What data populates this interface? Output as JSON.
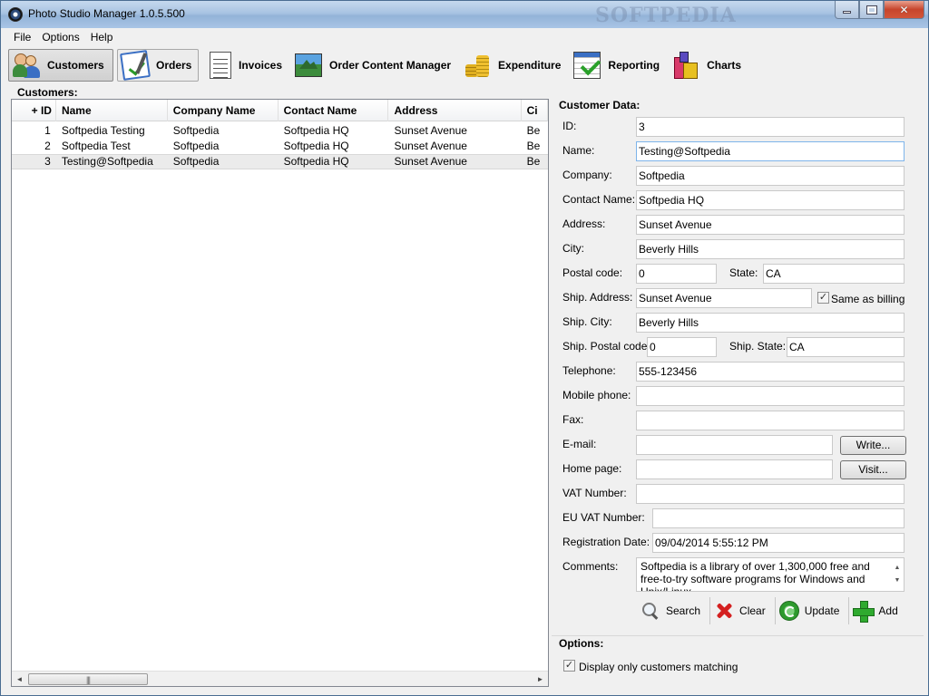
{
  "window": {
    "title": "Photo Studio Manager 1.0.5.500",
    "watermark": "SOFTPEDIA"
  },
  "menu": [
    "File",
    "Options",
    "Help"
  ],
  "toolbar": {
    "customers": "Customers",
    "orders": "Orders",
    "invoices": "Invoices",
    "content": "Order Content Manager",
    "expenditure": "Expenditure",
    "reporting": "Reporting",
    "charts": "Charts"
  },
  "customers_panel": {
    "label": "Customers:",
    "columns": {
      "id": "+ ID",
      "name": "Name",
      "company": "Company Name",
      "contact": "Contact Name",
      "address": "Address",
      "city": "Ci"
    },
    "rows": [
      {
        "id": "1",
        "name": "Softpedia Testing",
        "company": "Softpedia",
        "contact": "Softpedia HQ",
        "address": "Sunset Avenue",
        "city": "Be"
      },
      {
        "id": "2",
        "name": "Softpedia Test",
        "company": "Softpedia",
        "contact": "Softpedia HQ",
        "address": "Sunset Avenue",
        "city": "Be"
      },
      {
        "id": "3",
        "name": "Testing@Softpedia",
        "company": "Softpedia",
        "contact": "Softpedia HQ",
        "address": "Sunset Avenue",
        "city": "Be"
      }
    ],
    "scroll_grip": "|||"
  },
  "customer_data": {
    "label": "Customer Data:",
    "id_label": "ID:",
    "id": "3",
    "name_label": "Name:",
    "name": "Testing@Softpedia",
    "company_label": "Company:",
    "company": "Softpedia",
    "contact_label": "Contact Name:",
    "contact": "Softpedia HQ",
    "address_label": "Address:",
    "address": "Sunset Avenue",
    "city_label": "City:",
    "city": "Beverly Hills",
    "postal_label": "Postal code:",
    "postal": "0",
    "state_label": "State:",
    "state": "CA",
    "ship_address_label": "Ship. Address:",
    "ship_address": "Sunset Avenue",
    "same_as_billing": "Same as billing",
    "ship_city_label": "Ship. City:",
    "ship_city": "Beverly Hills",
    "ship_postal_label": "Ship. Postal code:",
    "ship_postal": "0",
    "ship_state_label": "Ship. State:",
    "ship_state": "CA",
    "telephone_label": "Telephone:",
    "telephone": "555-123456",
    "mobile_label": "Mobile phone:",
    "mobile": "",
    "fax_label": "Fax:",
    "fax": "",
    "email_label": "E-mail:",
    "email": "",
    "write_button": "Write...",
    "homepage_label": "Home page:",
    "homepage": "",
    "visit_button": "Visit...",
    "vat_label": "VAT Number:",
    "vat": "",
    "euvat_label": "EU VAT Number:",
    "euvat": "",
    "regdate_label": "Registration Date:",
    "regdate": "09/04/2014 5:55:12 PM",
    "comments_label": "Comments:",
    "comments": "Softpedia is a library of over 1,300,000 free and free-to-try software programs for Windows and Unix/Linux,"
  },
  "actions": {
    "search": "Search",
    "clear": "Clear",
    "update": "Update",
    "add": "Add"
  },
  "options": {
    "label": "Options:",
    "display_matching": "Display only customers matching"
  },
  "icons": {
    "scroll_left": "◄",
    "scroll_right": "►",
    "scroll_up": "▲",
    "scroll_down": "▼",
    "check": "✓"
  }
}
